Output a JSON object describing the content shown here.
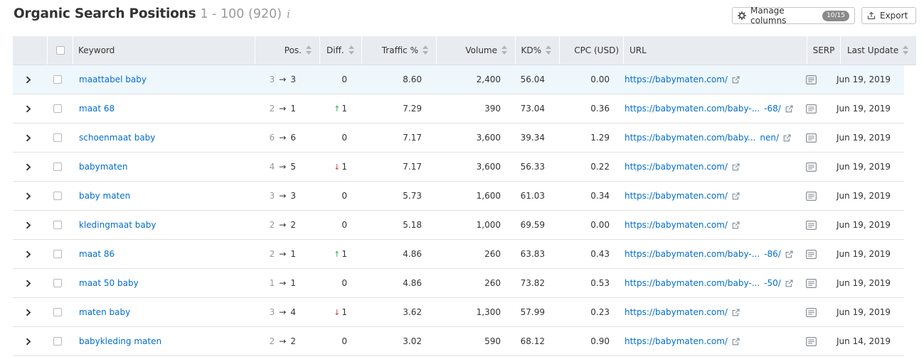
{
  "header": {
    "title": "Organic Search Positions",
    "range": "1 - 100 (920)",
    "info_icon": "i"
  },
  "toolbar": {
    "manage_label": "Manage columns",
    "manage_count": "10/15",
    "export_label": "Export"
  },
  "columns": {
    "keyword": "Keyword",
    "pos": "Pos.",
    "diff": "Diff.",
    "traffic": "Traffic %",
    "volume": "Volume",
    "kd": "KD%",
    "cpc": "CPC (USD)",
    "url": "URL",
    "serp": "SERP",
    "last_update": "Last Update"
  },
  "icons": {
    "expand": "chevron-right-icon",
    "gear": "gear-icon",
    "export": "export-icon",
    "external": "external-link-icon",
    "serp": "serp-snapshot-icon",
    "info": "info-icon"
  },
  "colors": {
    "link": "#006dca",
    "up": "#2fb344",
    "down": "#d33b3b",
    "header_bg": "#e8ecf1",
    "highlight_bg": "#eef7fc"
  },
  "rows": [
    {
      "keyword": "maattabel baby",
      "pos_prev": "3",
      "pos_arrow": "→",
      "pos_cur": "3",
      "diff_dir": "",
      "diff": "0",
      "traffic": "8.60",
      "volume": "2,400",
      "kd": "56.04",
      "cpc": "0.00",
      "url": "https://babymaten.com/",
      "url_suffix": "",
      "date": "Jun 19, 2019"
    },
    {
      "keyword": "maat 68",
      "pos_prev": "2",
      "pos_arrow": "→",
      "pos_cur": "1",
      "diff_dir": "↑",
      "diff": "1",
      "traffic": "7.29",
      "volume": "390",
      "kd": "73.04",
      "cpc": "0.36",
      "url": "https://babymaten.com/baby-...",
      "url_suffix": "-68/",
      "date": "Jun 19, 2019"
    },
    {
      "keyword": "schoenmaat baby",
      "pos_prev": "6",
      "pos_arrow": "→",
      "pos_cur": "6",
      "diff_dir": "",
      "diff": "0",
      "traffic": "7.17",
      "volume": "3,600",
      "kd": "39.34",
      "cpc": "1.29",
      "url": "https://babymaten.com/baby...",
      "url_suffix": "nen/",
      "date": "Jun 19, 2019"
    },
    {
      "keyword": "babymaten",
      "pos_prev": "4",
      "pos_arrow": "→",
      "pos_cur": "5",
      "diff_dir": "↓",
      "diff": "1",
      "traffic": "7.17",
      "volume": "3,600",
      "kd": "56.33",
      "cpc": "0.22",
      "url": "https://babymaten.com/",
      "url_suffix": "",
      "date": "Jun 19, 2019"
    },
    {
      "keyword": "baby maten",
      "pos_prev": "3",
      "pos_arrow": "→",
      "pos_cur": "3",
      "diff_dir": "",
      "diff": "0",
      "traffic": "5.73",
      "volume": "1,600",
      "kd": "61.03",
      "cpc": "0.34",
      "url": "https://babymaten.com/",
      "url_suffix": "",
      "date": "Jun 19, 2019"
    },
    {
      "keyword": "kledingmaat baby",
      "pos_prev": "2",
      "pos_arrow": "→",
      "pos_cur": "2",
      "diff_dir": "",
      "diff": "0",
      "traffic": "5.18",
      "volume": "1,000",
      "kd": "69.59",
      "cpc": "0.00",
      "url": "https://babymaten.com/",
      "url_suffix": "",
      "date": "Jun 19, 2019"
    },
    {
      "keyword": "maat 86",
      "pos_prev": "2",
      "pos_arrow": "→",
      "pos_cur": "1",
      "diff_dir": "↑",
      "diff": "1",
      "traffic": "4.86",
      "volume": "260",
      "kd": "63.83",
      "cpc": "0.43",
      "url": "https://babymaten.com/baby-...",
      "url_suffix": "-86/",
      "date": "Jun 19, 2019"
    },
    {
      "keyword": "maat 50 baby",
      "pos_prev": "1",
      "pos_arrow": "→",
      "pos_cur": "1",
      "diff_dir": "",
      "diff": "0",
      "traffic": "4.86",
      "volume": "260",
      "kd": "73.82",
      "cpc": "0.53",
      "url": "https://babymaten.com/baby-...",
      "url_suffix": "-50/",
      "date": "Jun 19, 2019"
    },
    {
      "keyword": "maten baby",
      "pos_prev": "3",
      "pos_arrow": "→",
      "pos_cur": "4",
      "diff_dir": "↓",
      "diff": "1",
      "traffic": "3.62",
      "volume": "1,300",
      "kd": "57.99",
      "cpc": "0.23",
      "url": "https://babymaten.com/",
      "url_suffix": "",
      "date": "Jun 19, 2019"
    },
    {
      "keyword": "babykleding maten",
      "pos_prev": "2",
      "pos_arrow": "→",
      "pos_cur": "2",
      "diff_dir": "",
      "diff": "0",
      "traffic": "3.02",
      "volume": "590",
      "kd": "68.12",
      "cpc": "0.90",
      "url": "https://babymaten.com/",
      "url_suffix": "",
      "date": "Jun 14, 2019"
    }
  ]
}
